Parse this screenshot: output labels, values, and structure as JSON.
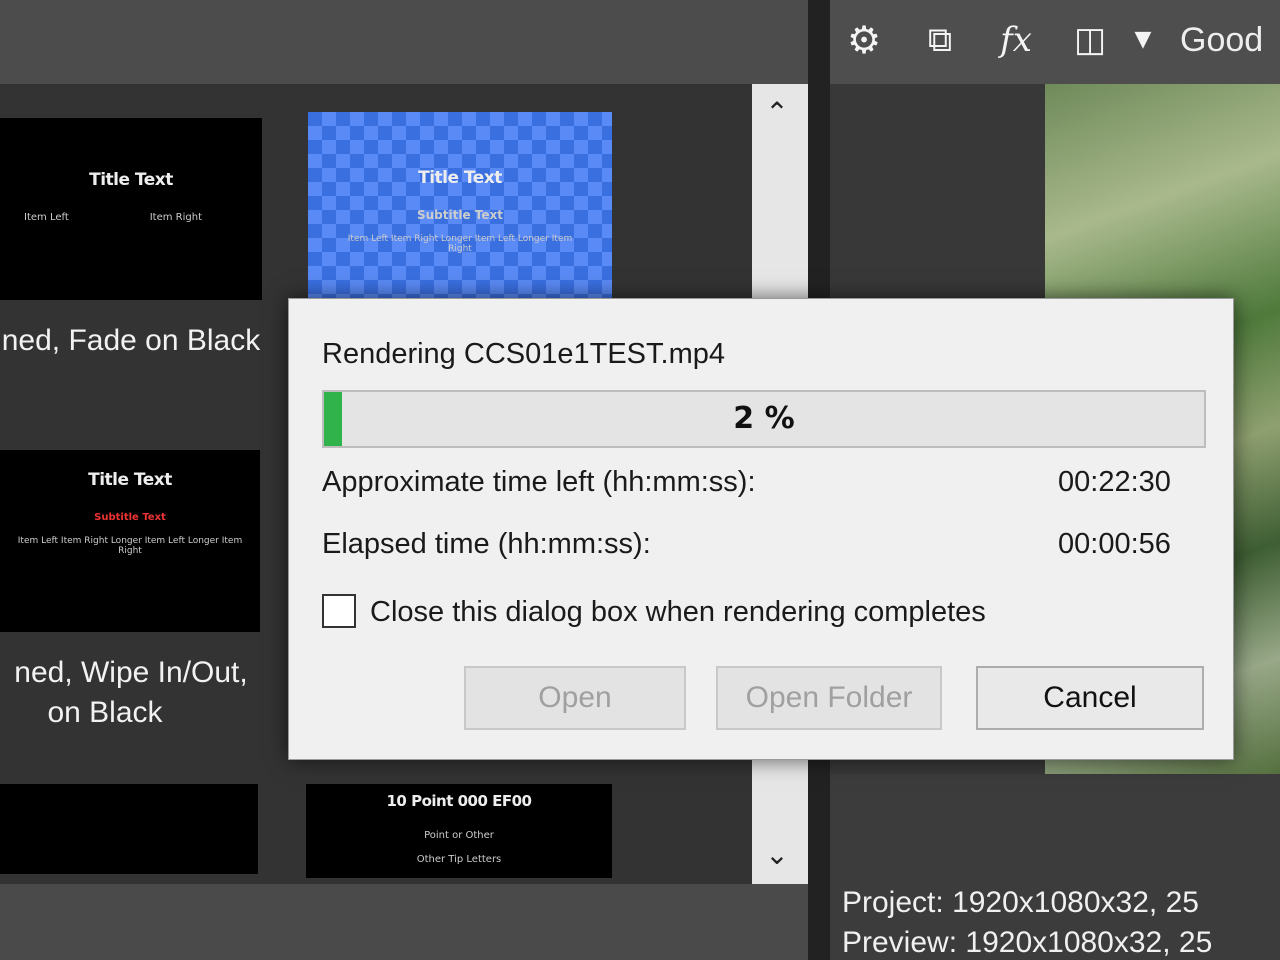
{
  "left_panel": {
    "thumbnails": [
      {
        "title": "Title Text",
        "sub1": "Item Left",
        "sub2": "Item Right",
        "style": "black"
      },
      {
        "title": "Title Text",
        "sub1": "Subtitle Text",
        "sub2": "Item Left  Item Right  Longer Item Left  Longer Item Right",
        "style": "checker"
      },
      {
        "title": "Title Text",
        "sub1": "Subtitle Text",
        "sub2": "Item Left  Item Right  Longer Item Left  Longer Item Right",
        "style": "black"
      },
      {
        "title": "10 Point 000 EF00",
        "sub1": "Point or Other",
        "sub2": "Other Tip Letters",
        "style": "black"
      }
    ],
    "captions": [
      "ned, Fade on Black",
      "ned, Wipe In/Out,",
      "on Black"
    ]
  },
  "toolbar": {
    "icons": [
      "gear-icon",
      "render-icon",
      "fx-icon",
      "split-screen-icon",
      "dropdown-arrow-icon"
    ],
    "preview_quality": "Good"
  },
  "preview_info": {
    "project_label": "Project:",
    "project_value": "1920x1080x32, 25",
    "preview_label": "Preview:",
    "preview_value": "1920x1080x32, 25"
  },
  "dialog": {
    "title": "Rendering CCS01e1TEST.mp4",
    "progress_percent": 2,
    "progress_label": "2 %",
    "time_left_label": "Approximate time left (hh:mm:ss):",
    "time_left_value": "00:22:30",
    "elapsed_label": "Elapsed time (hh:mm:ss):",
    "elapsed_value": "00:00:56",
    "close_checkbox_label": "Close this dialog box when rendering completes",
    "close_checkbox_checked": false,
    "buttons": {
      "open": "Open",
      "open_folder": "Open Folder",
      "cancel": "Cancel"
    },
    "colors": {
      "progress_fill": "#2fb34a",
      "background": "#f0f0f0"
    }
  }
}
